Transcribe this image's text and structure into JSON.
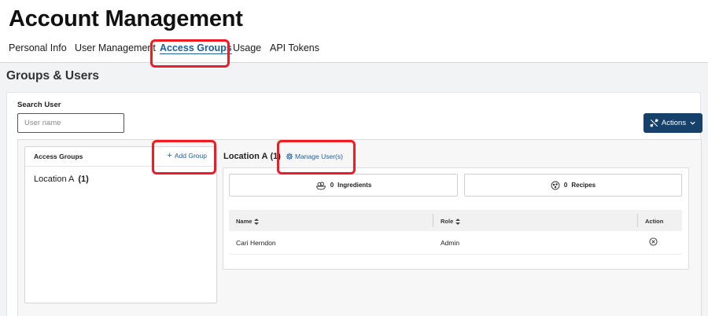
{
  "page": {
    "title": "Account Management"
  },
  "nav": {
    "tabs": [
      {
        "label": "Personal Info"
      },
      {
        "label": "User Management"
      },
      {
        "label": "Access Groups",
        "active": true
      },
      {
        "label": "Usage"
      },
      {
        "label": "API Tokens"
      }
    ]
  },
  "section": {
    "title": "Groups & Users"
  },
  "search": {
    "label": "Search User",
    "placeholder": "User name",
    "value": ""
  },
  "actions": {
    "label": "Actions",
    "icon": "tools-icon",
    "chevron": "chevron-down-icon"
  },
  "groups": {
    "title": "Access Groups",
    "add_label": "Add Group",
    "add_icon": "plus",
    "items": [
      {
        "name": "Location A",
        "count": "(1)"
      }
    ]
  },
  "location": {
    "title": "Location A",
    "count": "(1)",
    "manage_label": "Manage User(s)",
    "manage_icon": "gear-icon"
  },
  "stats": {
    "ingredients": {
      "count": "0",
      "label": "Ingredients",
      "icon": "ingredients-icon"
    },
    "recipes": {
      "count": "0",
      "label": "Recipes",
      "icon": "recipes-icon"
    }
  },
  "table": {
    "headers": {
      "name": "Name",
      "role": "Role",
      "action": "Action"
    },
    "rows": [
      {
        "name": "Cari Herndon",
        "role": "Admin",
        "action_icon": "close-circle-icon"
      }
    ]
  },
  "colors": {
    "primary": "#16416b",
    "link": "#1a5f9c",
    "highlight": "#ee1c24",
    "background": "#f2f3f5"
  }
}
